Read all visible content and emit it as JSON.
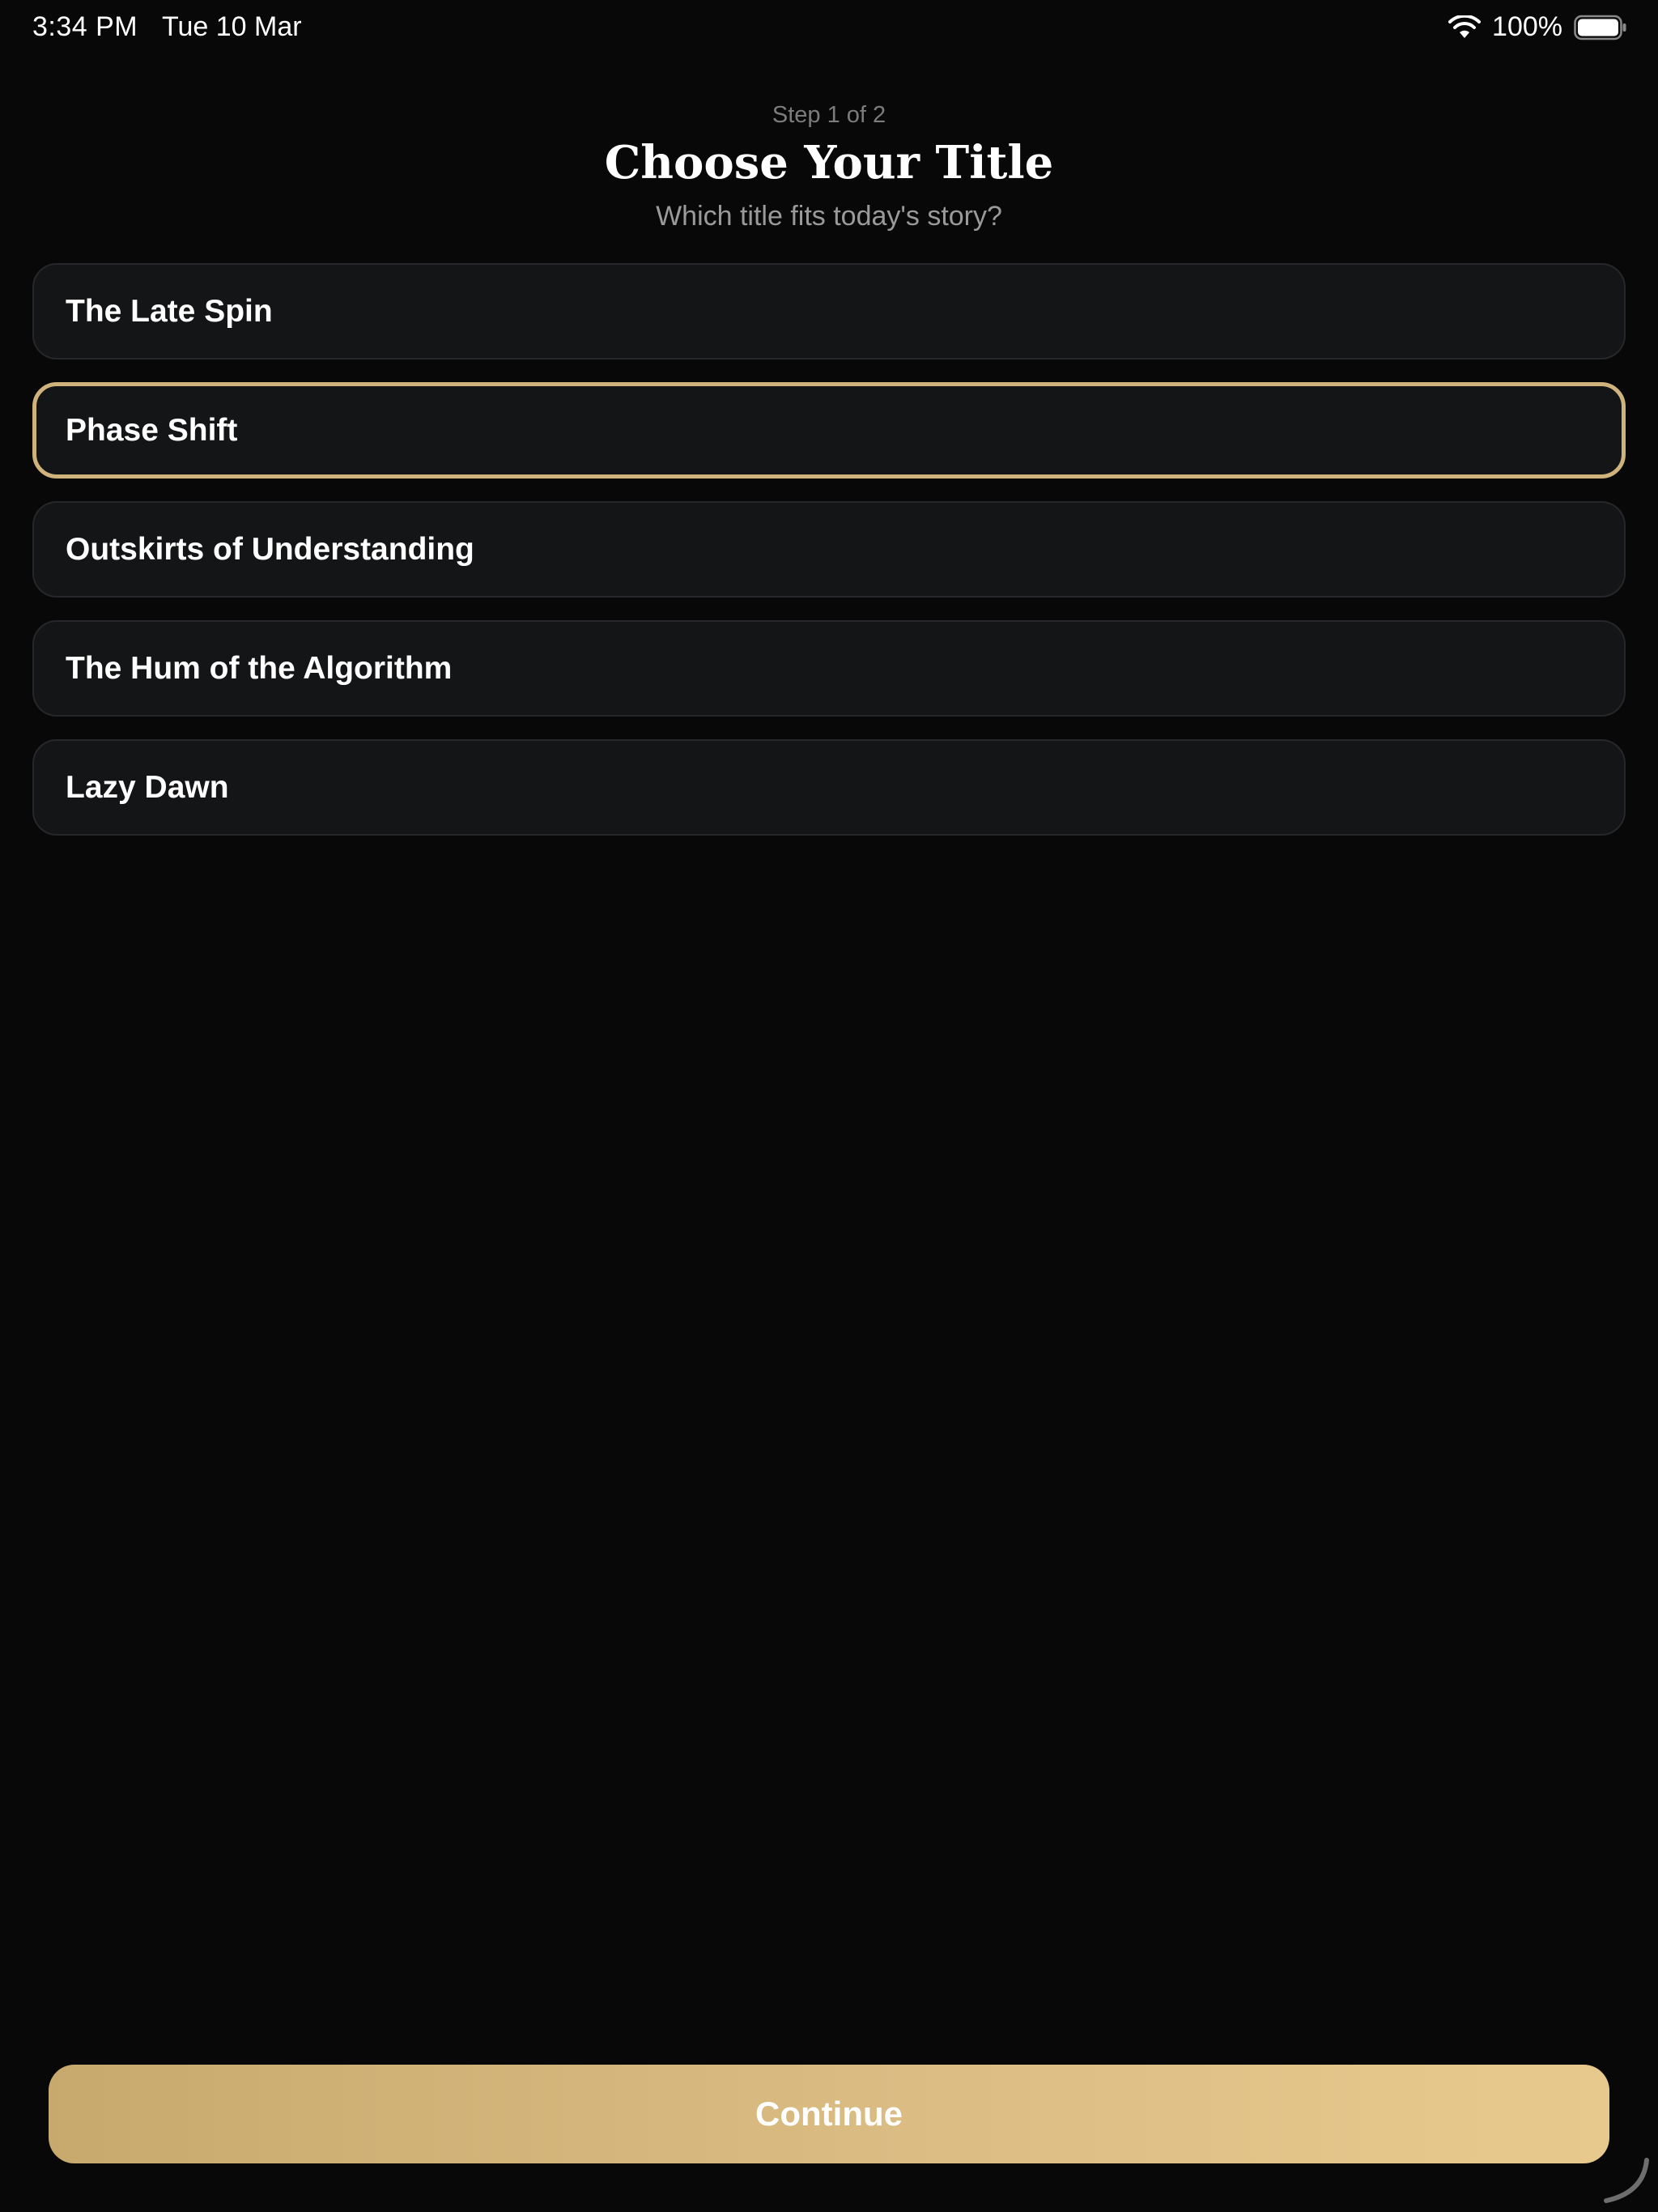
{
  "status_bar": {
    "time": "3:34 PM",
    "date": "Tue 10 Mar",
    "battery_percent": "100%",
    "wifi_icon": "wifi-icon",
    "battery_icon": "battery-full-icon"
  },
  "header": {
    "step": "Step 1 of 2",
    "title": "Choose Your Title",
    "subtitle": "Which title fits today's story?"
  },
  "options": [
    {
      "label": "The Late Spin",
      "selected": false
    },
    {
      "label": "Phase Shift",
      "selected": true
    },
    {
      "label": "Outskirts of Understanding",
      "selected": false
    },
    {
      "label": "The Hum of the Algorithm",
      "selected": false
    },
    {
      "label": "Lazy Dawn",
      "selected": false
    }
  ],
  "footer": {
    "continue_label": "Continue"
  },
  "colors": {
    "background": "#080808",
    "accent": "#cfb27c",
    "card": "#141517"
  }
}
